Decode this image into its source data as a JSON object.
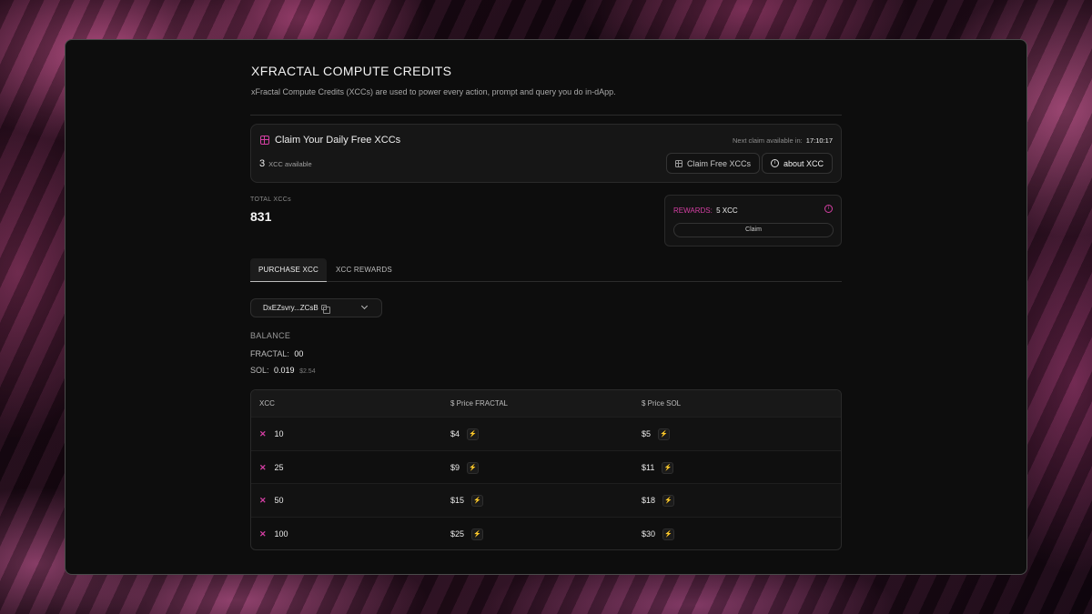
{
  "header": {
    "title": "XFRACTAL COMPUTE CREDITS",
    "subtitle": "xFractal Compute Credits (XCCs) are used to power every action, prompt and query you do in-dApp."
  },
  "daily_claim": {
    "title": "Claim Your Daily Free XCCs",
    "next_claim_label": "Next claim available in:",
    "next_claim_time": "17:10:17",
    "available_count": "3",
    "available_label": "XCC available",
    "claim_button": "Claim Free XCCs",
    "about_button": "about XCC"
  },
  "totals": {
    "label": "TOTAL XCCs",
    "value": "831"
  },
  "rewards": {
    "label": "REWARDS:",
    "value": "5 XCC",
    "claim_button": "Claim"
  },
  "tabs": [
    {
      "label": "PURCHASE XCC",
      "active": true
    },
    {
      "label": "XCC REWARDS",
      "active": false
    }
  ],
  "wallet": {
    "address": "DxEZsvry...ZCsB"
  },
  "balance": {
    "heading": "BALANCE",
    "fractal_label": "FRACTAL:",
    "fractal_value": "00",
    "sol_label": "SOL:",
    "sol_value": "0.019",
    "sol_usd": "$2.54"
  },
  "price_table": {
    "headers": [
      "XCC",
      "$ Price FRACTAL",
      "$ Price SOL"
    ],
    "rows": [
      {
        "xcc": "10",
        "fractal": "$4",
        "sol": "$5"
      },
      {
        "xcc": "25",
        "fractal": "$9",
        "sol": "$11"
      },
      {
        "xcc": "50",
        "fractal": "$15",
        "sol": "$18"
      },
      {
        "xcc": "100",
        "fractal": "$25",
        "sol": "$30"
      }
    ]
  },
  "colors": {
    "accent": "#d43fa3",
    "panel_bg": "#0d0d0d"
  },
  "icons": {
    "gift": "gift-icon",
    "info": "info-icon",
    "copy": "copy-icon",
    "chevron": "chevron-down-icon",
    "bolt": "lightning-icon",
    "xcc": "x-logo-icon"
  }
}
